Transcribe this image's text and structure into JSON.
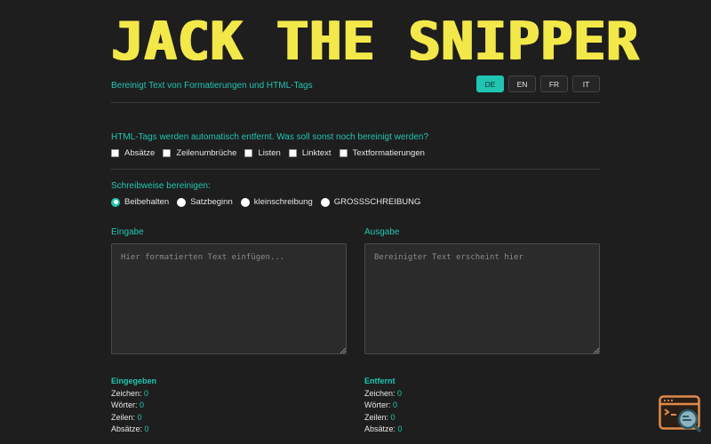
{
  "header": {
    "logo_text": "JACK THE SNIPPER",
    "subtitle": "Bereinigt Text von Formatierungen und HTML-Tags",
    "languages": [
      "DE",
      "EN",
      "FR",
      "IT"
    ],
    "active_language": "DE"
  },
  "cleanup": {
    "question": "HTML-Tags werden automatisch entfernt. Was soll sonst noch bereinigt werden?",
    "options": [
      "Absätze",
      "Zeilenumbrüche",
      "Listen",
      "Linktext",
      "Textformatierungen"
    ]
  },
  "case": {
    "label": "Schreibweise bereinigen:",
    "options": [
      "Beibehalten",
      "Satzbeginn",
      "kleinschreibung",
      "GROSSSCHREIBUNG"
    ],
    "selected": "Beibehalten"
  },
  "input": {
    "label": "Eingabe",
    "placeholder": "Hier formatierten Text einfügen..."
  },
  "output": {
    "label": "Ausgabe",
    "placeholder": "Bereinigter Text erscheint hier"
  },
  "stats_input": {
    "title": "Eingegeben",
    "items": [
      {
        "label": "Zeichen:",
        "value": "0"
      },
      {
        "label": "Wörter:",
        "value": "0"
      },
      {
        "label": "Zeilen:",
        "value": "0"
      },
      {
        "label": "Absätze:",
        "value": "0"
      }
    ]
  },
  "stats_removed": {
    "title": "Entfernt",
    "items": [
      {
        "label": "Zeichen:",
        "value": "0"
      },
      {
        "label": "Wörter:",
        "value": "0"
      },
      {
        "label": "Zeilen:",
        "value": "0"
      },
      {
        "label": "Absätze:",
        "value": "0"
      }
    ]
  },
  "colors": {
    "background": "#1e1e1e",
    "accent": "#20c5b2",
    "logo": "#f3e84a",
    "fab": "#e08a4a"
  },
  "fab_icon": "code-search-icon"
}
